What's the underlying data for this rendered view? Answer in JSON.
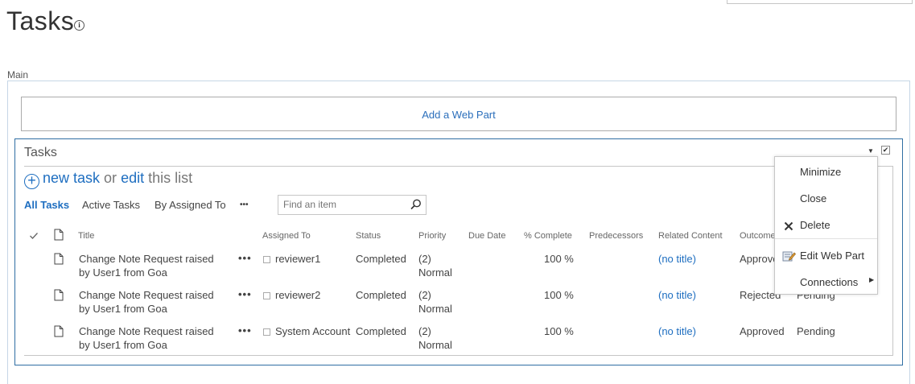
{
  "page": {
    "title": "Tasks",
    "zone_label": "Main",
    "add_web_part": "Add a Web Part"
  },
  "webpart": {
    "title": "Tasks",
    "new_task": "new task",
    "or": " or ",
    "edit": "edit",
    "this_list": " this list"
  },
  "views": {
    "items": [
      "All Tasks",
      "Active Tasks",
      "By Assigned To"
    ],
    "more": "•••",
    "search_placeholder": "Find an item"
  },
  "columns": [
    "Title",
    "Assigned To",
    "Status",
    "Priority",
    "Due Date",
    "% Complete",
    "Predecessors",
    "Related Content",
    "Outcome"
  ],
  "rows": [
    {
      "title_line1": "Change Note Request raised",
      "title_line2": "by User1 from Goa",
      "assigned": "reviewer1",
      "status": "Completed",
      "priority_line1": "(2)",
      "priority_line2": "Normal",
      "due": "",
      "complete": "100 %",
      "predecessors": "",
      "related": "(no title)",
      "outcome": "Approved",
      "extra": ""
    },
    {
      "title_line1": "Change Note Request raised",
      "title_line2": "by User1 from Goa",
      "assigned": "reviewer2",
      "status": "Completed",
      "priority_line1": "(2)",
      "priority_line2": "Normal",
      "due": "",
      "complete": "100 %",
      "predecessors": "",
      "related": "(no title)",
      "outcome": "Rejected",
      "extra": "Pending"
    },
    {
      "title_line1": "Change Note Request raised",
      "title_line2": "by User1 from Goa",
      "assigned": "System Account",
      "status": "Completed",
      "priority_line1": "(2)",
      "priority_line2": "Normal",
      "due": "",
      "complete": "100 %",
      "predecessors": "",
      "related": "(no title)",
      "outcome": "Approved",
      "extra": "Pending"
    }
  ],
  "menu": {
    "items": [
      "Minimize",
      "Close",
      "Delete",
      "Edit Web Part",
      "Connections"
    ]
  },
  "colors": {
    "accent": "#1e6ec0",
    "webpart_border": "#2f6ea3"
  }
}
